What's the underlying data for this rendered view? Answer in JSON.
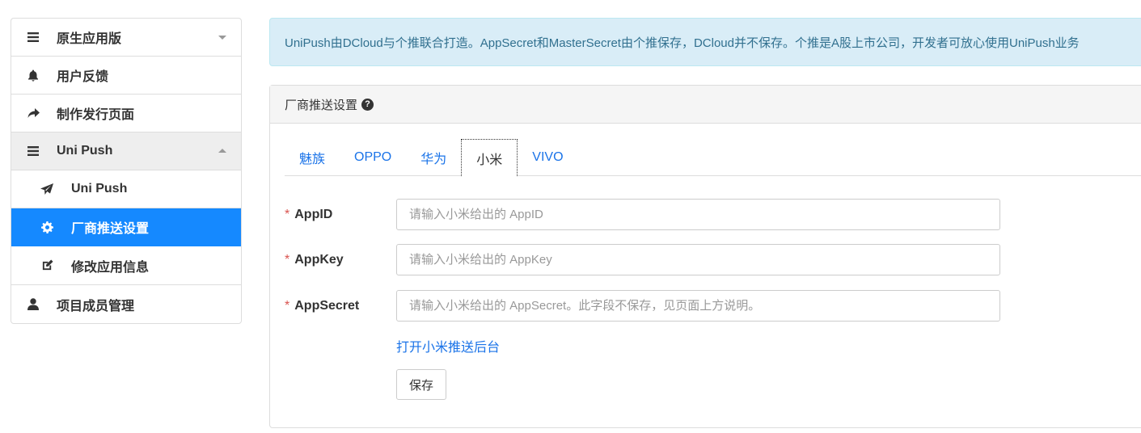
{
  "sidebar": {
    "items": [
      {
        "label": "原生应用版",
        "icon": "menu-icon",
        "caret": "down"
      },
      {
        "label": "用户反馈",
        "icon": "bell-icon"
      },
      {
        "label": "制作发行页面",
        "icon": "share-arrow-icon"
      },
      {
        "label": "Uni Push",
        "icon": "menu-icon",
        "caret": "up",
        "expanded": true
      },
      {
        "label": "Uni Push",
        "icon": "paper-plane-icon",
        "sub": true
      },
      {
        "label": "厂商推送设置",
        "icon": "gear-icon",
        "sub": true,
        "active": true
      },
      {
        "label": "修改应用信息",
        "icon": "edit-icon",
        "sub": true
      },
      {
        "label": "项目成员管理",
        "icon": "user-icon"
      }
    ]
  },
  "alert": {
    "text": "UniPush由DCloud与个推联合打造。AppSecret和MasterSecret由个推保存，DCloud并不保存。个推是A股上市公司，开发者可放心使用UniPush业务"
  },
  "panel": {
    "title": "厂商推送设置",
    "help_icon": "question-circle-icon",
    "tabs": [
      "魅族",
      "OPPO",
      "华为",
      "小米",
      "VIVO"
    ],
    "active_tab": "小米",
    "fields": [
      {
        "label": "AppID",
        "placeholder": "请输入小米给出的 AppID",
        "value": ""
      },
      {
        "label": "AppKey",
        "placeholder": "请输入小米给出的 AppKey",
        "value": ""
      },
      {
        "label": "AppSecret",
        "placeholder": "请输入小米给出的 AppSecret。此字段不保存，见页面上方说明。",
        "value": ""
      }
    ],
    "required_mark": "*",
    "link_text": "打开小米推送后台",
    "save_label": "保存"
  },
  "colors": {
    "active_bg": "#1589ff",
    "link": "#1a73e8",
    "alert_bg": "#d9edf7",
    "alert_text": "#31708f",
    "required": "#d9534f"
  }
}
